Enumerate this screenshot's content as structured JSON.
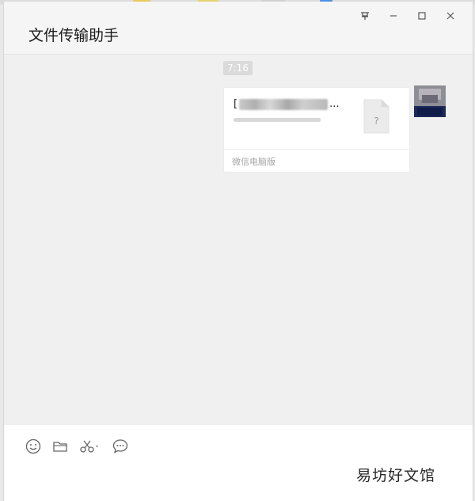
{
  "window": {
    "title": "文件传输助手",
    "controls": {
      "pin_icon": "pin-icon",
      "minimize_icon": "minimize-icon",
      "maximize_icon": "maximize-icon",
      "close_icon": "close-icon"
    }
  },
  "chat": {
    "timestamp": "7:16",
    "message": {
      "file_name_prefix": "[",
      "file_name_suffix": "...",
      "file_icon_glyph": "?",
      "source_label": "微信电脑版"
    }
  },
  "toolbar": {
    "items": [
      {
        "name": "emoji-icon"
      },
      {
        "name": "folder-icon"
      },
      {
        "name": "scissors-icon"
      },
      {
        "name": "chat-history-icon"
      }
    ]
  },
  "watermark": "易坊好文馆"
}
